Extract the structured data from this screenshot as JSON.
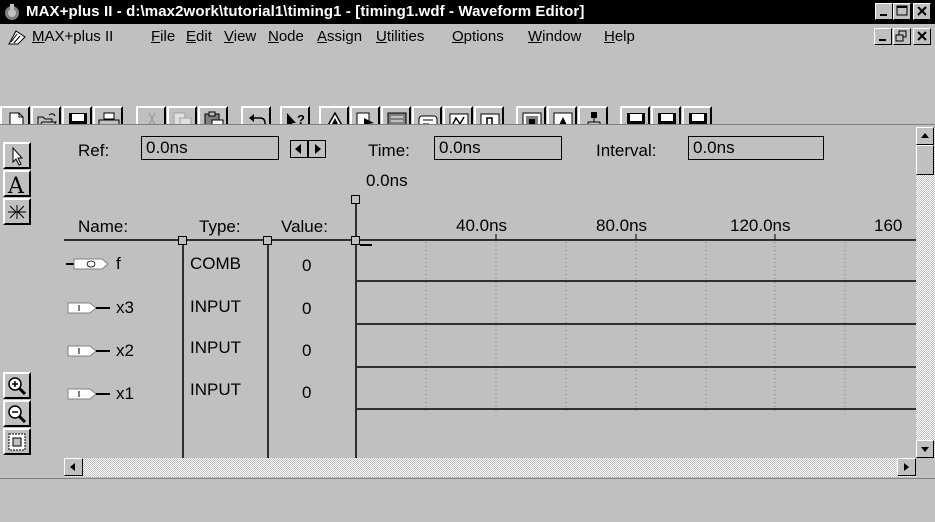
{
  "window": {
    "title": "MAX+plus II - d:\\max2work\\tutorial1\\timing1 - [timing1.wdf - Waveform Editor]"
  },
  "menu": {
    "items": [
      {
        "label": "MAX+plus II",
        "accel": "M"
      },
      {
        "label": "File",
        "accel": "F"
      },
      {
        "label": "Edit",
        "accel": "E"
      },
      {
        "label": "View",
        "accel": "V"
      },
      {
        "label": "Node",
        "accel": "N"
      },
      {
        "label": "Assign",
        "accel": "A"
      },
      {
        "label": "Utilities",
        "accel": "U"
      },
      {
        "label": "Options",
        "accel": "O"
      },
      {
        "label": "Window",
        "accel": "W"
      },
      {
        "label": "Help",
        "accel": "H"
      }
    ]
  },
  "toolbar": {
    "buttons": [
      "new-icon",
      "open-icon",
      "save-icon",
      "print-icon",
      "cut-icon",
      "copy-icon",
      "paste-icon",
      "undo-icon",
      "context-help-icon",
      "hierarchy-up-icon",
      "hierarchy-display-icon",
      "floorplan-editor-icon",
      "compiler-icon",
      "simulator-icon",
      "timing-analyzer-icon",
      "open-editor-icon",
      "open-symbol-icon",
      "project-top-icon",
      "save-check-icon",
      "save-compile-icon",
      "save-simulate-icon"
    ]
  },
  "editor": {
    "ref_label": "Ref:",
    "ref_value": "0.0ns",
    "time_label": "Time:",
    "time_value": "0.0ns",
    "interval_label": "Interval:",
    "interval_value": "0.0ns",
    "cursor_time": "0.0ns",
    "col_name": "Name:",
    "col_type": "Type:",
    "col_value": "Value:",
    "ticks": [
      "40.0ns",
      "80.0ns",
      "120.0ns",
      "160"
    ],
    "signals": [
      {
        "name": "f",
        "type": "COMB",
        "value": "0",
        "pin": "output"
      },
      {
        "name": "x3",
        "type": "INPUT",
        "value": "0",
        "pin": "input"
      },
      {
        "name": "x2",
        "type": "INPUT",
        "value": "0",
        "pin": "input"
      },
      {
        "name": "x1",
        "type": "INPUT",
        "value": "0",
        "pin": "input"
      }
    ]
  },
  "palette": {
    "tools": [
      "select-arrow-icon",
      "text-tool-icon",
      "waveform-draw-icon",
      "zoom-in-icon",
      "zoom-out-icon",
      "fit-in-window-icon"
    ]
  },
  "statusbar": {
    "text": ""
  }
}
